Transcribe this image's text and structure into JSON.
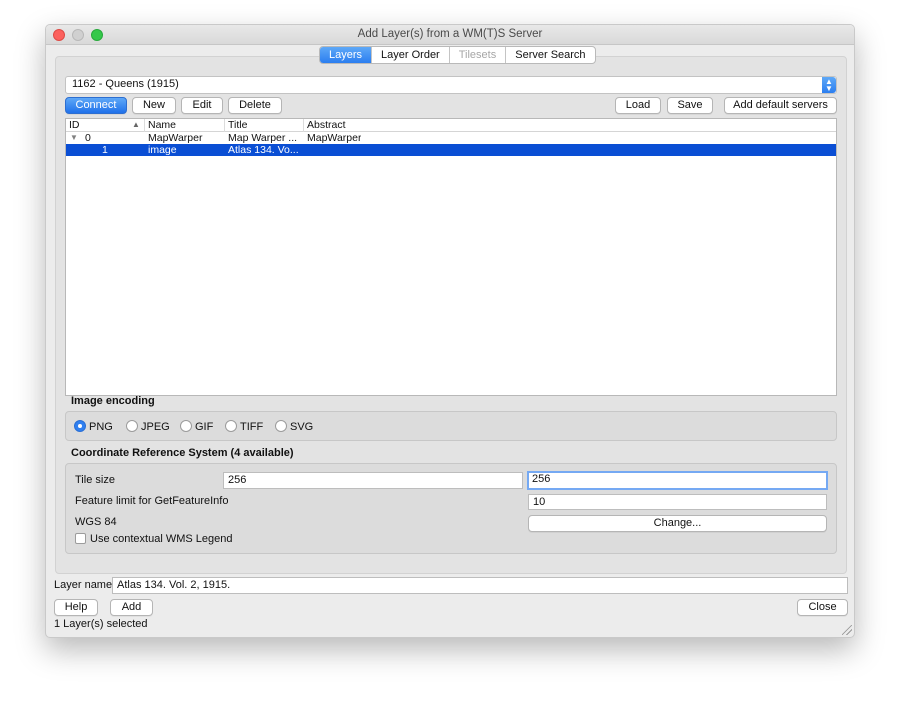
{
  "window": {
    "title": "Add Layer(s) from a WM(T)S Server"
  },
  "tabs": [
    {
      "label": "Layers"
    },
    {
      "label": "Layer Order"
    },
    {
      "label": "Tilesets"
    },
    {
      "label": "Server Search"
    }
  ],
  "connection": {
    "selected": "1162 - Queens (1915)"
  },
  "buttons": {
    "connect": "Connect",
    "new": "New",
    "edit": "Edit",
    "delete": "Delete",
    "load": "Load",
    "save": "Save",
    "add_default": "Add default servers"
  },
  "table": {
    "columns": [
      "ID",
      "Name",
      "Title",
      "Abstract"
    ],
    "rows": [
      {
        "id": "0",
        "name": "MapWarper",
        "title": "Map Warper ...",
        "abstract": "MapWarper"
      },
      {
        "id": "1",
        "name": "image",
        "title": "Atlas 134. Vo...",
        "abstract": ""
      }
    ]
  },
  "encoding": {
    "label": "Image encoding",
    "options": [
      "PNG",
      "JPEG",
      "GIF",
      "TIFF",
      "SVG"
    ],
    "selected": "PNG"
  },
  "crs": {
    "label": "Coordinate Reference System (4 available)",
    "tile_size_label": "Tile size",
    "tile_width": "256",
    "tile_height": "256",
    "feature_limit_label": "Feature limit for GetFeatureInfo",
    "feature_limit": "10",
    "crs_name": "WGS 84",
    "change_button": "Change...",
    "legend_label": "Use contextual WMS Legend"
  },
  "layer_name": {
    "label": "Layer name",
    "value": "Atlas 134. Vol. 2, 1915."
  },
  "footer": {
    "help": "Help",
    "add": "Add",
    "close": "Close",
    "status": "1 Layer(s) selected"
  },
  "colors": {
    "accent": "#2b7ef0",
    "selection": "#0a4ed4"
  }
}
